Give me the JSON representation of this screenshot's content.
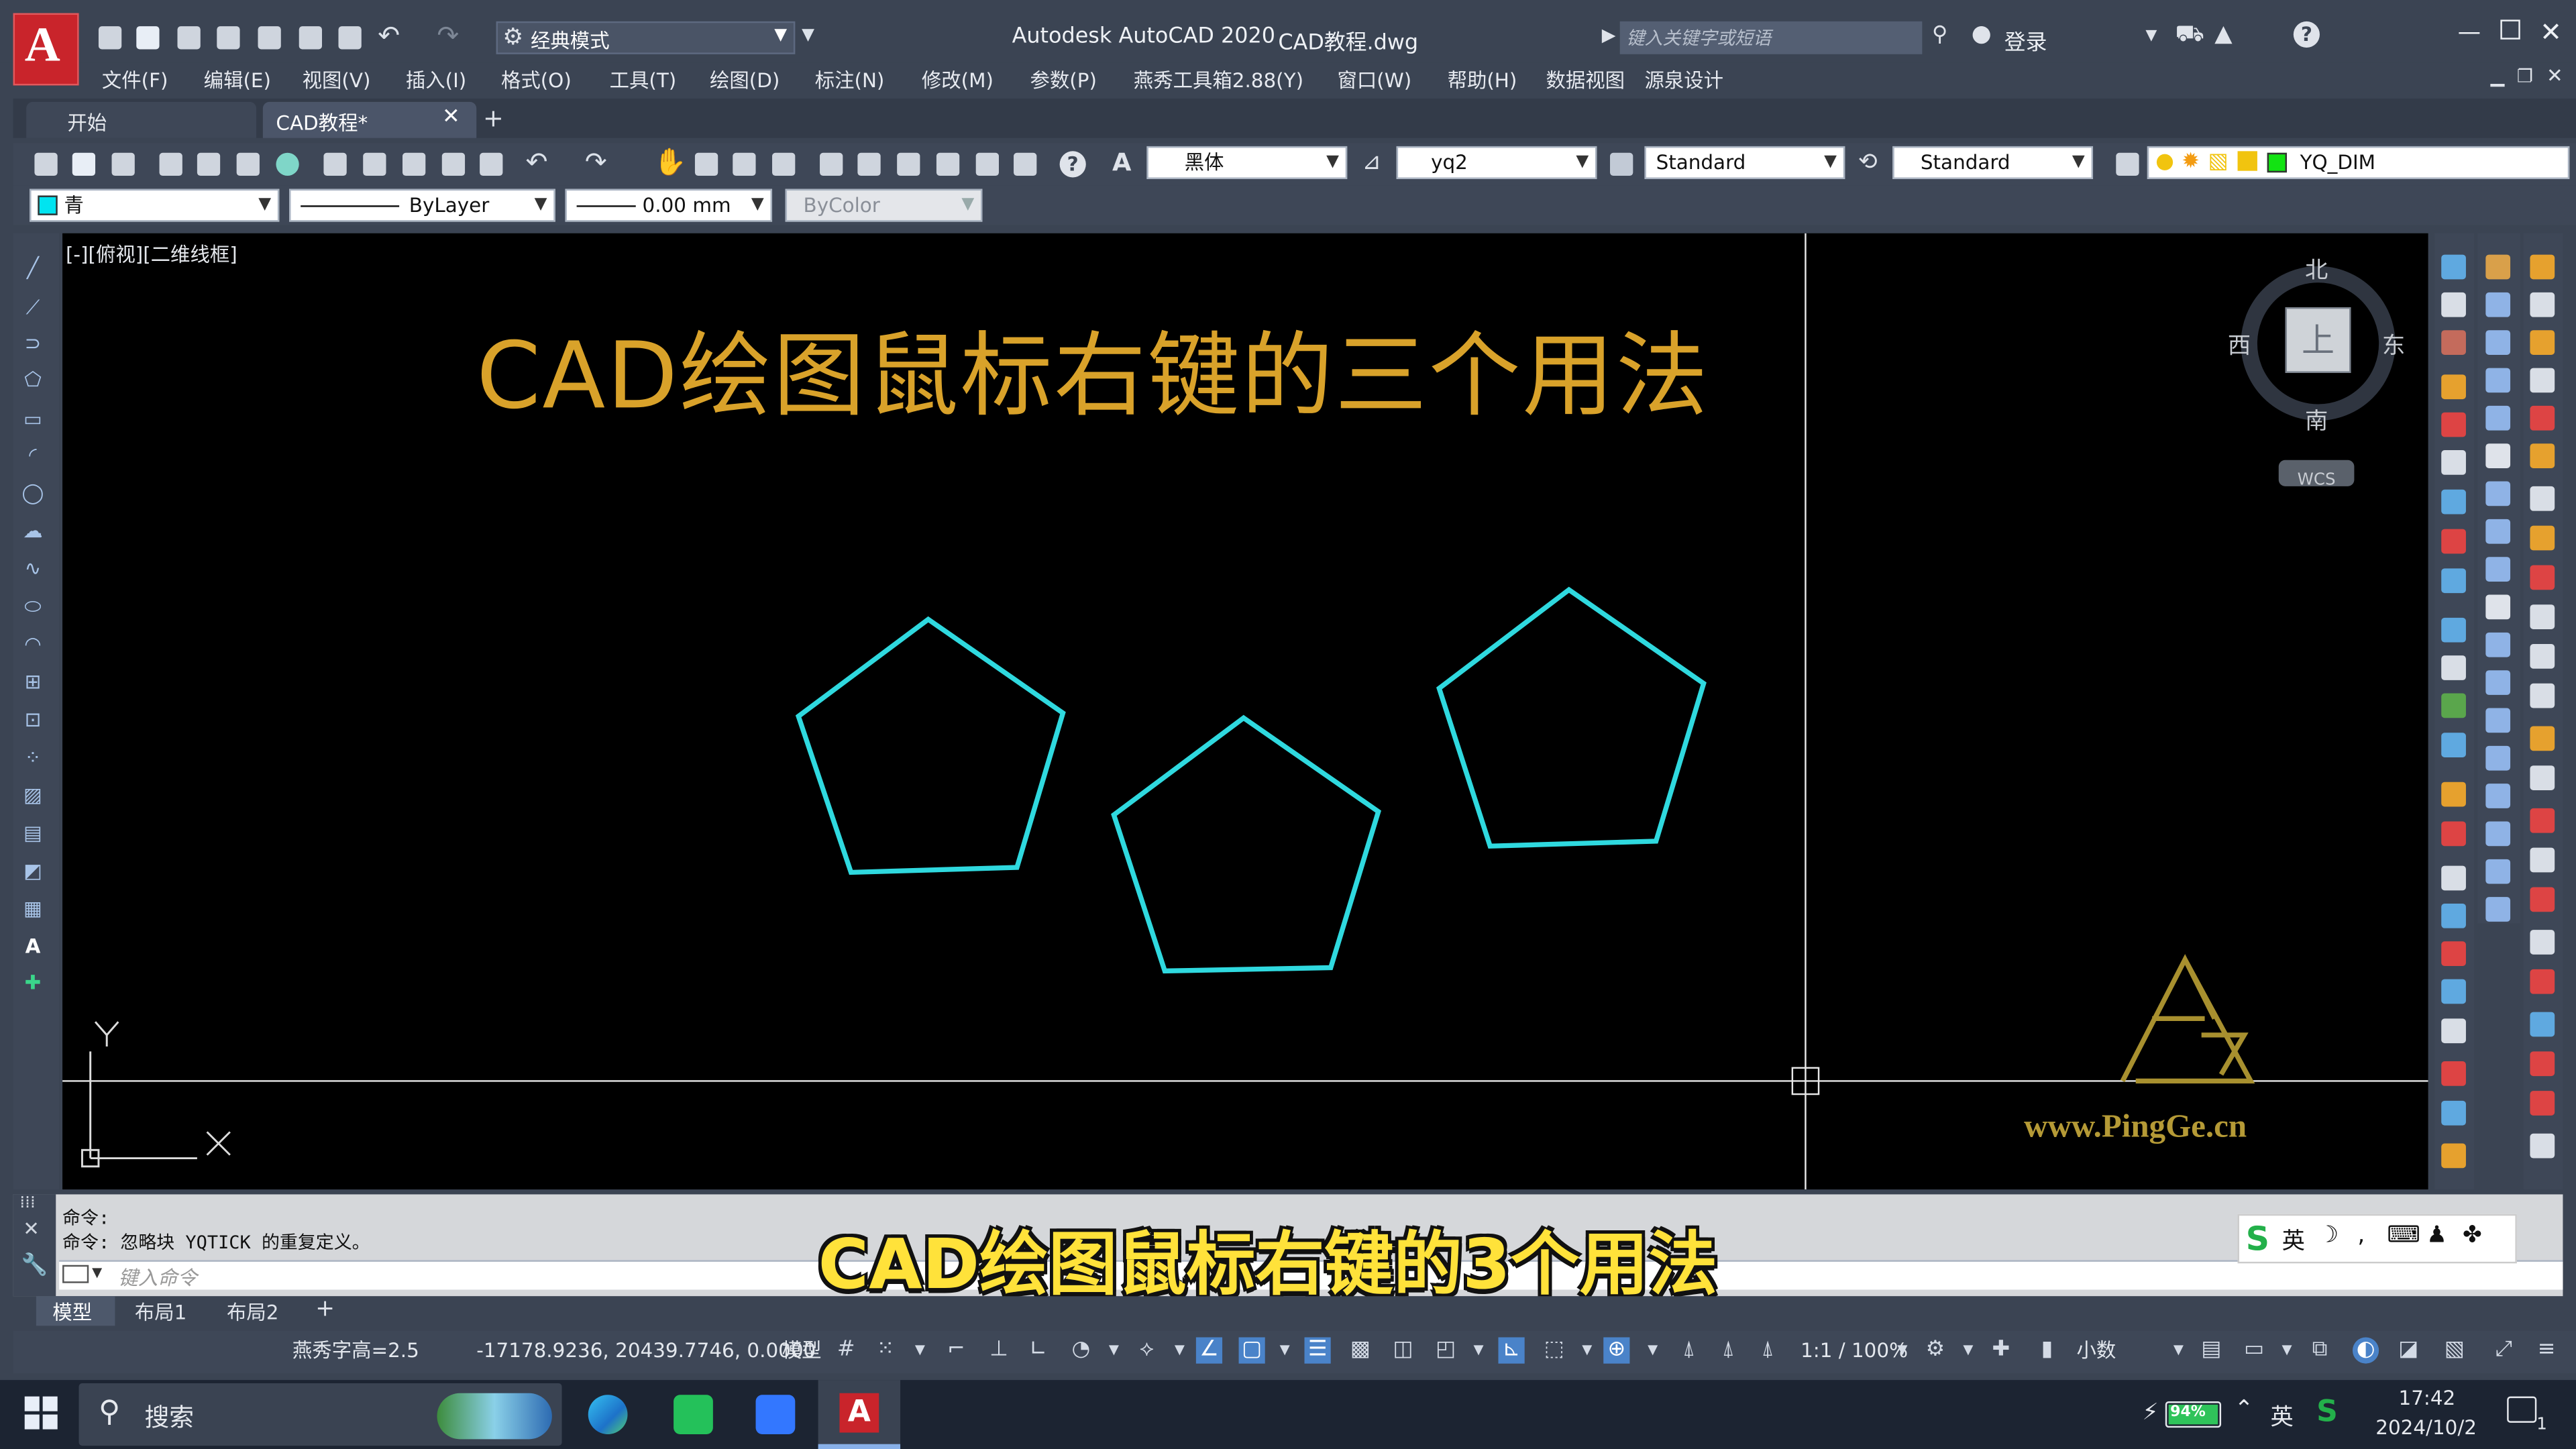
{
  "titlebar": {
    "workspace": "经典模式",
    "app_title": "Autodesk AutoCAD 2020",
    "file_title": "CAD教程.dwg",
    "search_placeholder": "键入关键字或短语",
    "login": "登录"
  },
  "menu": [
    "文件(F)",
    "编辑(E)",
    "视图(V)",
    "插入(I)",
    "格式(O)",
    "工具(T)",
    "绘图(D)",
    "标注(N)",
    "修改(M)",
    "参数(P)",
    "燕秀工具箱2.88(Y)",
    "窗口(W)",
    "帮助(H)",
    "数据视图",
    "源泉设计"
  ],
  "tabs": {
    "start": "开始",
    "active": "CAD教程*",
    "add": "+"
  },
  "ribbon": {
    "font": "黑体",
    "dim_style": "yq2",
    "text_style": "Standard",
    "table_style": "Standard",
    "layer": "YQ_DIM"
  },
  "props": {
    "color": "青",
    "linetype": "ByLayer",
    "lineweight": "0.00 mm",
    "plot_style": "ByColor"
  },
  "canvas": {
    "view_label": "[-][俯视][二维线框]",
    "title": "CAD绘图鼠标右键的三个用法",
    "watermark_url": "www.PingGe.cn",
    "y_axis": "Y"
  },
  "viewcube": {
    "north": "北",
    "south": "南",
    "west": "西",
    "east": "东",
    "top": "上",
    "wcs": "WCS"
  },
  "command": {
    "line1": "命令:",
    "line2": "命令:  忽略块 YQTICK 的重复定义。",
    "placeholder": "键入命令"
  },
  "subtitle": "CAD绘图鼠标右键的3个用法",
  "ime": {
    "lang": "英"
  },
  "layout_tabs": [
    "模型",
    "布局1",
    "布局2"
  ],
  "statusbar": {
    "text_height": "燕秀字高=2.5",
    "coords": "-17178.9236, 20439.7746, 0.0000",
    "model": "模型",
    "scale": "1:1 / 100%",
    "units": "小数"
  },
  "taskbar": {
    "search": "搜索",
    "battery": "94%",
    "lang": "英",
    "time": "17:42",
    "date": "2024/10/2",
    "notifications": "1"
  },
  "colors": {
    "canvas_bg": "#000000",
    "pentagon": "#2fd9df",
    "title_text": "#d9a22a",
    "subtitle_text": "#ffe23a",
    "logo_gold": "#a8902f",
    "ui_bg": "#3b4453"
  }
}
